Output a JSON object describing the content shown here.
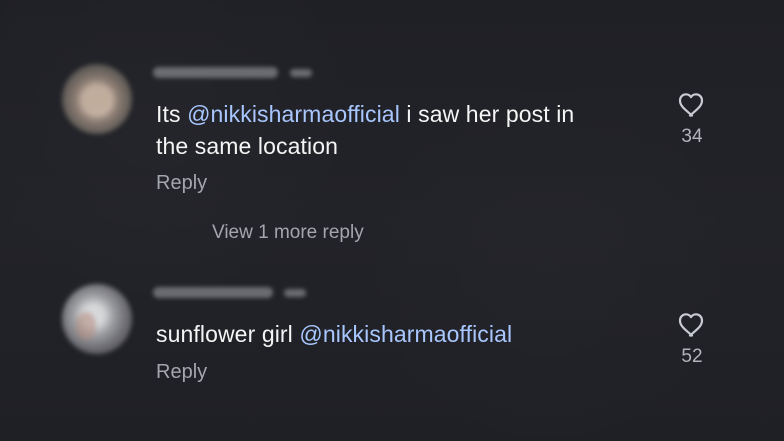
{
  "comments": [
    {
      "text_prefix": "Its ",
      "mention": "@nikkisharmaofficial",
      "text_suffix": " i saw her post in",
      "line2": "the same location",
      "reply_label": "Reply",
      "likes": "34",
      "more_replies_label": "View 1 more reply"
    },
    {
      "text_prefix": "sunflower girl ",
      "mention": "@nikkisharmaofficial",
      "reply_label": "Reply",
      "likes": "52"
    }
  ],
  "icons": {
    "like": "heart-icon",
    "avatar": "avatar"
  },
  "colors": {
    "background": "#202126",
    "text": "#f5f5f5",
    "mention": "#a9c7ff",
    "secondary": "#a4a6ad"
  }
}
